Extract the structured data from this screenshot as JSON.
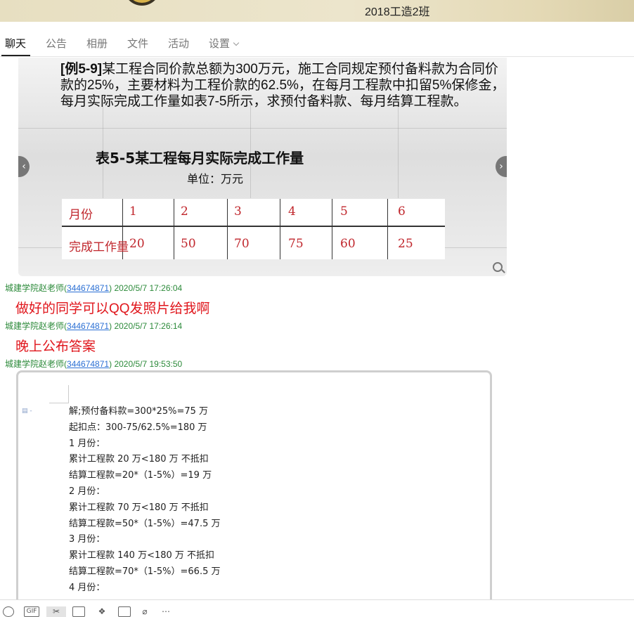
{
  "header": {
    "title": "2018工造2班"
  },
  "tabs": [
    {
      "label": "聊天",
      "active": true
    },
    {
      "label": "公告"
    },
    {
      "label": "相册"
    },
    {
      "label": "文件"
    },
    {
      "label": "活动"
    },
    {
      "label": "设置"
    }
  ],
  "image_message": {
    "problem_example": "[例5-9]",
    "problem_text": "某工程合同价款总额为300万元，施工合同规定预付备料款为合同价款的25%，主要材料为工程价款的62.5%，在每月工程款中扣留5%保修金，每月实际完成工作量如表7-5所示，求预付备料款、每月结算工程款。",
    "table_title": "表5-5某工程每月实际完成工作量",
    "table_unit": "单位：万元",
    "row1": [
      "月份",
      "1",
      "2",
      "3",
      "4",
      "5",
      "6"
    ],
    "row2": [
      "完成工作量",
      "20",
      "50",
      "70",
      "75",
      "60",
      "25"
    ]
  },
  "messages": [
    {
      "sender": "城建学院赵老师",
      "qq": "344674871",
      "time": "2020/5/7 17:26:04",
      "text": "做好的同学可以QQ发照片给我啊"
    },
    {
      "sender": "城建学院赵老师",
      "qq": "344674871",
      "time": "2020/5/7 17:26:14",
      "text": "晚上公布答案"
    },
    {
      "sender": "城建学院赵老师",
      "qq": "344674871",
      "time": "2020/5/7 19:53:50"
    }
  ],
  "answer_doc": {
    "lines": [
      "解;预付备料款=300*25%=75 万",
      "起扣点：300-75/62.5%=180  万",
      "1 月份：",
      "累计工程款 20 万<180  万  不抵扣",
      "结算工程款=20*（1-5%）=19  万",
      "2 月份：",
      "累计工程款 70 万<180  万  不抵扣",
      "结算工程款=50*（1-5%）=47.5  万",
      "3 月份：",
      "累计工程款 140 万<180  万  不抵扣",
      "结算工程款=70*（1-5%）=66.5  万",
      "4 月份："
    ]
  },
  "toolbar": {
    "gif_label": "GIF"
  },
  "colors": {
    "sender": "#2c8a3a",
    "message": "#e0161c",
    "qq_link": "#2a6fd4",
    "table_text": "#c0262c"
  }
}
